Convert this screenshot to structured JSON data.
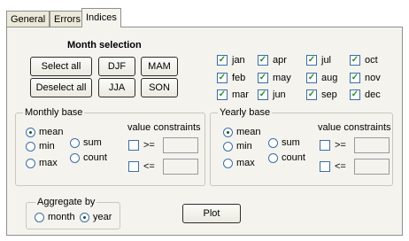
{
  "tabs": [
    {
      "label": "General"
    },
    {
      "label": "Errors"
    },
    {
      "label": "Indices"
    }
  ],
  "month_selection": {
    "title": "Month selection",
    "select_all": "Select all",
    "deselect_all": "Deselect all",
    "seasons": [
      "DJF",
      "MAM",
      "JJA",
      "SON"
    ],
    "check_mark": "✓",
    "months": [
      {
        "label": "jan",
        "checked": true
      },
      {
        "label": "apr",
        "checked": true
      },
      {
        "label": "jul",
        "checked": true
      },
      {
        "label": "oct",
        "checked": true
      },
      {
        "label": "feb",
        "checked": true
      },
      {
        "label": "may",
        "checked": true
      },
      {
        "label": "aug",
        "checked": true
      },
      {
        "label": "nov",
        "checked": true
      },
      {
        "label": "mar",
        "checked": true
      },
      {
        "label": "jun",
        "checked": true
      },
      {
        "label": "sep",
        "checked": true
      },
      {
        "label": "dec",
        "checked": true
      }
    ]
  },
  "monthly_base": {
    "title": "Monthly base",
    "options": {
      "mean": "mean",
      "min": "min",
      "max": "max",
      "sum": "sum",
      "count": "count"
    },
    "selected": "mean",
    "constraints_label": "value constraints",
    "ge_label": ">=",
    "le_label": "<=",
    "ge_value": "",
    "le_value": ""
  },
  "yearly_base": {
    "title": "Yearly base",
    "options": {
      "mean": "mean",
      "min": "min",
      "max": "max",
      "sum": "sum",
      "count": "count"
    },
    "selected": "mean",
    "constraints_label": "value constraints",
    "ge_label": ">=",
    "le_label": "<=",
    "ge_value": "",
    "le_value": ""
  },
  "aggregate": {
    "title": "Aggregate by",
    "month": "month",
    "year": "year",
    "selected": "year"
  },
  "plot_button": "Plot"
}
